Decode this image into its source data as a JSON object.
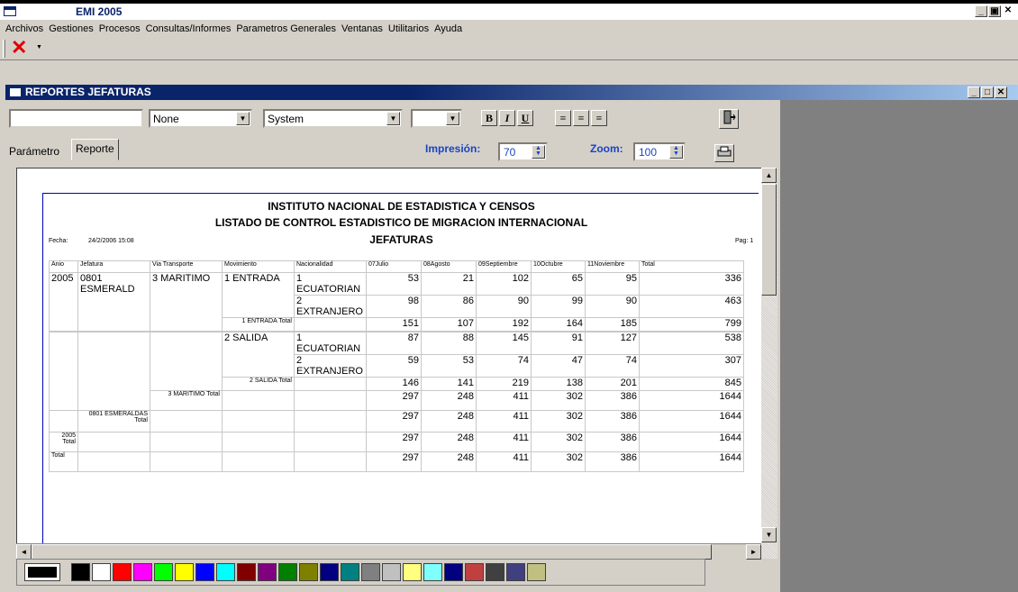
{
  "app": {
    "title": "EMI 2005"
  },
  "menu": [
    "Archivos",
    "Gestiones",
    "Procesos",
    "Consultas/Informes",
    "Parametros Generales",
    "Ventanas",
    "Utilitarios",
    "Ayuda"
  ],
  "window": {
    "title": "REPORTES JEFATURAS"
  },
  "format_toolbar": {
    "font_name": "",
    "style": "None",
    "font": "System",
    "size": "",
    "bold": "B",
    "italic": "I",
    "underline": "U"
  },
  "tabs": {
    "parametro": "Parámetro",
    "reporte": "Reporte"
  },
  "impresion": {
    "label": "Impresión:",
    "value": "70"
  },
  "zoom": {
    "label": "Zoom:",
    "value": "100"
  },
  "report": {
    "title1": "INSTITUTO NACIONAL  DE ESTADISTICA Y CENSOS",
    "title2": "LISTADO DE CONTROL ESTADISTICO DE MIGRACION INTERNACIONAL",
    "title3": "JEFATURAS",
    "fecha_label": "Fecha:",
    "fecha": "24/2/2006 15:08",
    "page": "Pag: 1",
    "headers": [
      "Anio",
      "Jefatura",
      "Via Transporte",
      "Movimiento",
      "Nacionalidad",
      "07Julio",
      "08Agosto",
      "09Septiembre",
      "10Octubre",
      "11Noviembre",
      "Total"
    ],
    "year": "2005",
    "jefatura": "0801 ESMERALD",
    "via": "3 MARITIMO",
    "mov_entrada": "1 ENTRADA",
    "mov_salida": "2 SALIDA",
    "nac1": "1 ECUATORIAN",
    "nac2": "2 EXTRANJERO",
    "entrada_ecu": [
      "53",
      "21",
      "102",
      "65",
      "95",
      "336"
    ],
    "entrada_ext": [
      "98",
      "86",
      "90",
      "99",
      "90",
      "463"
    ],
    "entrada_total_label": "1 ENTRADA Total",
    "entrada_total": [
      "151",
      "107",
      "192",
      "164",
      "185",
      "799"
    ],
    "salida_ecu": [
      "87",
      "88",
      "145",
      "91",
      "127",
      "538"
    ],
    "salida_ext": [
      "59",
      "53",
      "74",
      "47",
      "74",
      "307"
    ],
    "salida_total_label": "2 SALIDA Total",
    "salida_total": [
      "146",
      "141",
      "219",
      "138",
      "201",
      "845"
    ],
    "maritimo_total_label": "3 MARITIMO Total",
    "maritimo_total": [
      "297",
      "248",
      "411",
      "302",
      "386",
      "1644"
    ],
    "esmeraldas_total_label1": "0801 ESMERALDAS",
    "esmeraldas_total_label2": "Total",
    "esmeraldas_total": [
      "297",
      "248",
      "411",
      "302",
      "386",
      "1644"
    ],
    "year_total_label1": "2005",
    "year_total_label2": "Total",
    "year_total": [
      "297",
      "248",
      "411",
      "302",
      "386",
      "1644"
    ],
    "grand_total_label": "Total",
    "grand_total": [
      "297",
      "248",
      "411",
      "302",
      "386",
      "1644"
    ]
  },
  "palette": [
    "#000000",
    "#ffffff",
    "#ff0000",
    "#ff00ff",
    "#00ff00",
    "#ffff00",
    "#0000ff",
    "#00ffff",
    "#800000",
    "#800080",
    "#008000",
    "#808000",
    "#000080",
    "#008080",
    "#808080",
    "#c0c0c0",
    "#ffff80",
    "#80ffff",
    "#000080",
    "#c04040",
    "#404040",
    "#404080",
    "#c0c080"
  ]
}
